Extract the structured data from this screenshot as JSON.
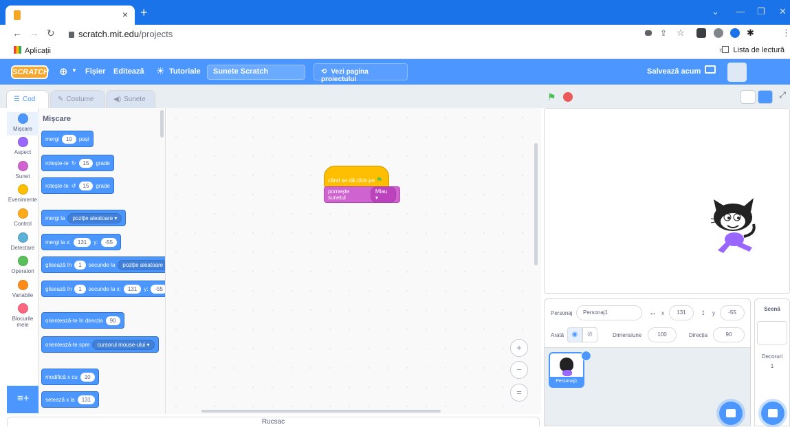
{
  "browser": {
    "tab_close": "×",
    "new_tab": "+",
    "url_domain": "scratch.mit.edu",
    "url_path": "/projects",
    "bookmarks_apps": "Aplicații",
    "reading_list": "Lista de lectură",
    "bookmarks_more": "»"
  },
  "menu": {
    "logo": "SCRATCH",
    "file": "Fișier",
    "edit": "Editează",
    "tutorials": "Tutoriale",
    "project_title": "Sunete Scratch",
    "view_project": "Vezi pagina proiectului",
    "save_now": "Salvează acum"
  },
  "editor_tabs": [
    "Cod",
    "Costume",
    "Sunete"
  ],
  "categories": [
    {
      "label": "Mișcare",
      "color": "#4c97ff"
    },
    {
      "label": "Aspect",
      "color": "#9966ff"
    },
    {
      "label": "Sunet",
      "color": "#cf63cf"
    },
    {
      "label": "Evenimente",
      "color": "#ffbf00"
    },
    {
      "label": "Control",
      "color": "#ffab19"
    },
    {
      "label": "Detectare",
      "color": "#5cb1d6"
    },
    {
      "label": "Operatori",
      "color": "#59c059"
    },
    {
      "label": "Variabile",
      "color": "#ff8c1a"
    },
    {
      "label": "Blocurile mele",
      "color": "#ff6680"
    }
  ],
  "palette": {
    "heading": "Mișcare",
    "move": {
      "a": "mergi",
      "steps": "10",
      "b": "pași"
    },
    "turn_right": {
      "a": "rotește-te",
      "deg": "15",
      "b": "grade"
    },
    "turn_left": {
      "a": "rotește-te",
      "deg": "15",
      "b": "grade"
    },
    "goto": {
      "a": "mergi la",
      "target": "poziție aleatoare"
    },
    "goto_xy": {
      "a": "mergi la x:",
      "x": "131",
      "b": "y:",
      "y": "-55"
    },
    "glide_to": {
      "a": "glisează în",
      "secs": "1",
      "b": "secunde la",
      "target": "poziție aleatoare"
    },
    "glide_xy": {
      "a": "glisează în",
      "secs": "1",
      "b": "secunde la x:",
      "x": "131",
      "c": "y:",
      "y": "-55"
    },
    "point_dir": {
      "a": "orientează-te în direcția",
      "dir": "90"
    },
    "point_towards": {
      "a": "orientează-te spre",
      "target": "cursorul mouse-ului"
    },
    "change_x": {
      "a": "modifică x cu",
      "val": "10"
    },
    "set_x": {
      "a": "setează x la",
      "val": "131"
    }
  },
  "script": {
    "hat": "când se dă click pe",
    "sound_block": "pornește sunetul",
    "sound_value": "Miau"
  },
  "zoom": {
    "in": "+",
    "out": "−",
    "reset": "="
  },
  "backpack": "Rucsac",
  "sprite_info": {
    "sprite_label": "Personaj",
    "sprite_name": "Personaj1",
    "x_label": "x",
    "x": "131",
    "y_label": "y",
    "y": "-55",
    "show_label": "Arată",
    "size_label": "Dimensiune",
    "size": "100",
    "direction_label": "Direcția",
    "direction": "90"
  },
  "sprites": [
    {
      "name": "Personaj1"
    }
  ],
  "stage_pane": {
    "title": "Scenă",
    "backdrops_label": "Decoruri",
    "backdrops_count": "1"
  }
}
